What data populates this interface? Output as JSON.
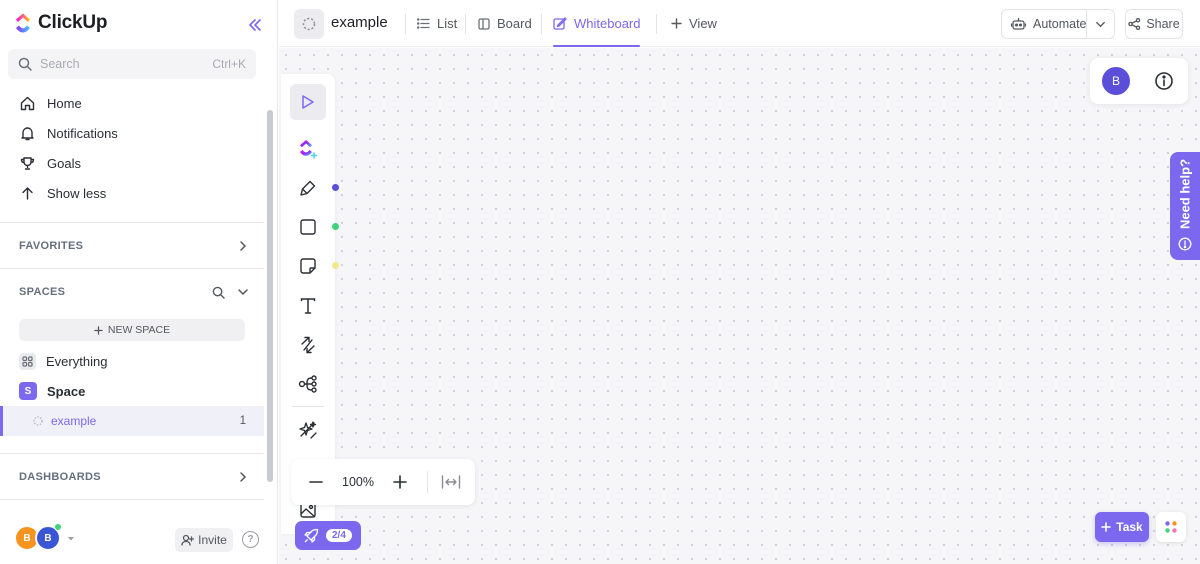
{
  "app": {
    "name": "ClickUp"
  },
  "search": {
    "placeholder": "Search",
    "shortcut": "Ctrl+K"
  },
  "nav": {
    "items": [
      {
        "label": "Home",
        "icon": "home-icon"
      },
      {
        "label": "Notifications",
        "icon": "bell-icon"
      },
      {
        "label": "Goals",
        "icon": "trophy-icon"
      },
      {
        "label": "Show less",
        "icon": "arrow-up-icon"
      }
    ]
  },
  "sections": {
    "favorites": "FAVORITES",
    "spaces": "SPACES",
    "dashboards": "DASHBOARDS"
  },
  "spaces": {
    "new_space_label": "NEW SPACE",
    "everything_label": "Everything",
    "space_label": "Space",
    "space_initial": "S",
    "list_label": "example",
    "list_count": "1"
  },
  "footer": {
    "avatars": [
      {
        "initial": "B",
        "color": "#f7941d"
      },
      {
        "initial": "B",
        "color": "#3a56d4"
      }
    ],
    "invite_label": "Invite",
    "help_label": "?"
  },
  "topbar": {
    "doc_title": "example",
    "views": [
      {
        "label": "List",
        "icon": "list-icon"
      },
      {
        "label": "Board",
        "icon": "board-icon"
      },
      {
        "label": "Whiteboard",
        "icon": "whiteboard-icon",
        "active": true
      },
      {
        "label": "View",
        "icon": "plus-icon"
      }
    ],
    "automate_label": "Automate",
    "share_label": "Share"
  },
  "canvas": {
    "zoom": "100%",
    "progress": "2/4",
    "user_initial": "B",
    "need_help_label": "Need help?",
    "task_label": "Task"
  },
  "colors": {
    "accent": "#7b68ee",
    "pen_dot": "#5b4fd9",
    "shape_dot": "#3fd37a",
    "sticky_dot": "#f3e88a"
  }
}
